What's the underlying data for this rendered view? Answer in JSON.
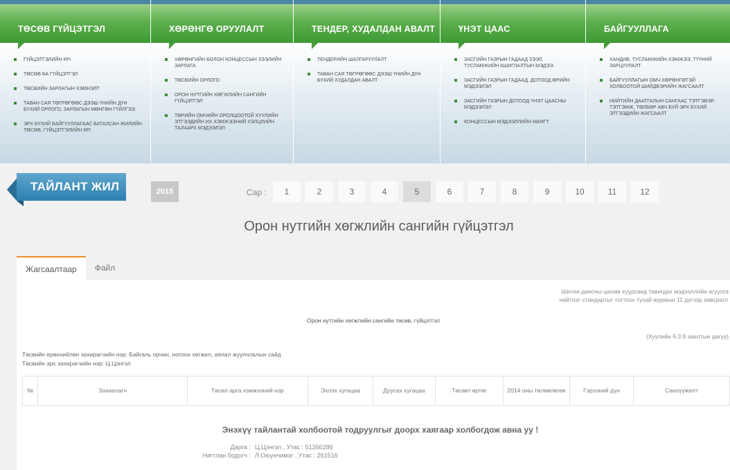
{
  "nav": [
    {
      "title": "ТӨСӨВ ГҮЙЦЭТГЭЛ",
      "items": [
        "ГҮЙЦЭТГЭЛИЙН КPI",
        "ТӨСӨВ БА ГҮЙЦЭТГЭЛ",
        "ТӨСВИЙН ЗАРЛАГЫН ХЭМНЭЛТ",
        "ТАВАН САЯ ТӨГРӨГӨӨС ДЭЭШ ҮНИЙН ДҮН БҮХИЙ ОРЛОГО, ЗАРЛАГЫН МӨНГӨН ГҮЙЛГЭЭ",
        "ЭРХ БҮХИЙ БАЙГУУЛЛАГААС БАТАЛСАН ЖИЛИЙН ТӨСӨВ, ГҮЙЦЭТГЭЛИЙН КPI"
      ]
    },
    {
      "title": "ХӨРӨНГӨ ОРУУЛАЛТ",
      "items": [
        "ХӨРӨНГИЙН БОЛОН КОНЦЕССЫН ЗЭЭЛИЙН ЗАРЛАГА",
        "ТӨСВИЙН ОРЛОГО",
        "ОРОН НУТГИЙН ХӨГЖЛИЙН САНГИЙН ГҮЙЦЭТГЭЛ",
        "ТӨРИЙН ОМЧИЙН ОРОЛЦООТОЙ ХУУЛИЙН ЭТГЭЭДИЙН ИХ ХЭМЖЭЭНИЙ ХЭЛЦЛИЙН ТАЛААРХ МЭДЭЭЛЭЛ"
      ]
    },
    {
      "title": "ТЕНДЕР, ХУДАЛДАН АВАЛТ",
      "items": [
        "ТЕНДЕРИЙН ШАЛГАРУУЛАЛТ",
        "ТАВАН САЯ ТӨГРӨГӨӨС ДЭЭШ ҮНИЙН ДҮН БҮХИЙ ХУДАЛДАН АВАЛТ"
      ]
    },
    {
      "title": "ҮНЭТ ЦААС",
      "items": [
        "ЗАСГИЙН ГАЗРЫН ГАДААД ЗЭЭЛ, ТУСЛАМЖИЙН АШИГЛАЛТЫН МЭДЭЭ",
        "ЗАСГИЙН ГАЗРЫН ГАДААД, ДОТООД ӨРИЙН МЭДЭЭЛЭЛ",
        "ЗАСГИЙН ГАЗРЫН ДОТООД ҮНЭТ ЦААСНЫ МЭДЭЭЛЭЛ",
        "КОНЦЕССЫН МЭДЭЭЛЛИЙН МАЯГТ"
      ]
    },
    {
      "title": "БАЙГУУЛЛАГА",
      "items": [
        "ХАНДИВ, ТУСЛАМЖИЙН ХЭМЖЭЭ, ТҮҮНИЙ ЗАРЦУУЛАЛТ",
        "БАЙГУУЛЛАГЫН ОМЧ ХӨРӨНГӨТЭЙ ХОЛБООТОЙ ШИЙДВЭРИЙН ЖАГСААЛТ",
        "НИЙТИЙН ДААТГАЛЫН САНГААС ТЭТГЭВЭР, ТЭТГЭМЖ, ТӨЛБӨР АВЧ БУЙ ЭРХ БҮХИЙ ЭТГЭЭДИЙН ЖАГСААЛТ"
      ]
    }
  ],
  "report": {
    "ribbon": "ТАЙЛАНТ ЖИЛ",
    "year": "2015",
    "month_label": "Сар :",
    "months": [
      "1",
      "2",
      "3",
      "4",
      "5",
      "6",
      "7",
      "8",
      "9",
      "10",
      "11",
      "12"
    ],
    "active_month": "5"
  },
  "page_title": "Орон нутгийн хөгжлийн сангийн гүйцэтгэл",
  "tabs": [
    "Жагсаалтаар",
    "Файл"
  ],
  "content": {
    "note_line1": "Шилэн дансны цахим хуудсанд тавигдах мэдээллийн агуулга",
    "note_line2": "нийтлэг стандартыг тогтоох тухай журмын 11 дүгээр хавсралт",
    "table_caption": "Орон нутгийн хөгжлийн сангийн төсөв, гүйцэтгэл",
    "law_ref": "(Хуулийн 6.3.9 заалтын дагуу)",
    "manager_line": "Төсвийн ерөнхийлөн захирагчийн нэр: Байгаль орчин, ногоон хөгжил, аялал жуулчлалын сайд",
    "admin_line": "Төсвийн эрх захирагчийн нэр: Ц.Цэнгэл"
  },
  "table": {
    "headers": [
      "№",
      "Захиалагч",
      "Төсөл арга хэмжээний нэр",
      "Эхлэх хугацаа",
      "Дуусах хугацаа",
      "Төсөвт өртөг",
      "2014 оны төлөвлөгөө",
      "Гэрээний дүн",
      "Санхүүжилт"
    ]
  },
  "contact": {
    "heading": "Энэхүү тайлантай холбоотой тодруулгыг доорх хаягаар холбогдож авна уу !",
    "rows": [
      {
        "key": "Дарга :",
        "value": "Ц.Цэнгэл , Утас : 51266286"
      },
      {
        "key": "Нягтлан бодогч :",
        "value": "Л.Оюунчимэг , Утас : 261516"
      }
    ]
  }
}
